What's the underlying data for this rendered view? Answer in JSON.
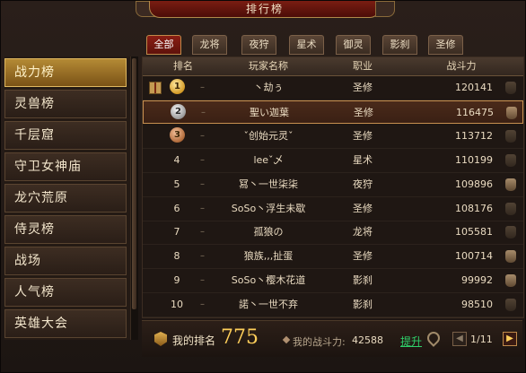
{
  "window": {
    "title": "排行榜"
  },
  "sidebar": {
    "items": [
      {
        "label": "战力榜",
        "active": true
      },
      {
        "label": "灵兽榜"
      },
      {
        "label": "千层窟"
      },
      {
        "label": "守卫女神庙"
      },
      {
        "label": "龙穴荒原"
      },
      {
        "label": "侍灵榜"
      },
      {
        "label": "战场"
      },
      {
        "label": "人气榜"
      },
      {
        "label": "英雄大会"
      }
    ]
  },
  "tabs": [
    {
      "label": "全部",
      "active": true
    },
    {
      "label": "龙将"
    },
    {
      "label": "夜狩"
    },
    {
      "label": "星术"
    },
    {
      "label": "御灵"
    },
    {
      "label": "影刹"
    },
    {
      "label": "圣修"
    }
  ],
  "table": {
    "headers": {
      "rank": "排名",
      "name": "玩家名称",
      "class": "职业",
      "power": "战斗力"
    },
    "rows": [
      {
        "rank": "1",
        "change": "–",
        "name": "丶劫ぅ",
        "class": "圣修",
        "power": "120141",
        "medal": "gold",
        "gift": true
      },
      {
        "rank": "2",
        "change": "–",
        "name": "聖い迦葉",
        "class": "圣修",
        "power": "116475",
        "medal": "silver",
        "highlight": true
      },
      {
        "rank": "3",
        "change": "–",
        "name": "ˇ创始元灵ˇ",
        "class": "圣修",
        "power": "113712",
        "medal": "bronze"
      },
      {
        "rank": "4",
        "change": "–",
        "name": "leeˇ乄",
        "class": "星术",
        "power": "110199"
      },
      {
        "rank": "5",
        "change": "–",
        "name": "冩丶一世柒柒",
        "class": "夜狩",
        "power": "109896"
      },
      {
        "rank": "6",
        "change": "–",
        "name": "SoSo丶浮生未歇",
        "class": "圣修",
        "power": "108176"
      },
      {
        "rank": "7",
        "change": "–",
        "name": "孤狼の",
        "class": "龙将",
        "power": "105581"
      },
      {
        "rank": "8",
        "change": "–",
        "name": "狼族,,,扯蛋",
        "class": "圣修",
        "power": "100714"
      },
      {
        "rank": "9",
        "change": "–",
        "name": "SoSo丶樱木花道",
        "class": "影刹",
        "power": "99992"
      },
      {
        "rank": "10",
        "change": "–",
        "name": "諾丶一世不弃",
        "class": "影刹",
        "power": "98510"
      }
    ]
  },
  "footer": {
    "my_rank_label": "我的排名",
    "my_rank_value": "775",
    "my_power_label": "我的战斗力:",
    "my_power_value": "42588",
    "upgrade_label": "提升",
    "page_indicator": "1/11",
    "prev_glyph": "◀",
    "next_glyph": "▶"
  },
  "colors": {
    "accent": "#c89050",
    "active_tab": "#8a1e14",
    "sidebar_active": "#b48a35",
    "upgrade": "#2fd06a",
    "rank_value": "#ffcf5a"
  }
}
